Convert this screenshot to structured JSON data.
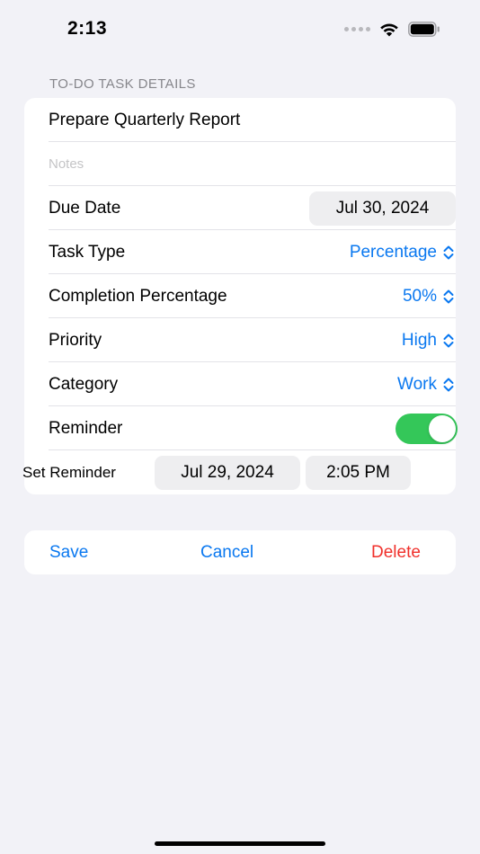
{
  "status_bar": {
    "time": "2:13",
    "icons": [
      "cellular-dots-icon",
      "wifi-icon",
      "battery-icon"
    ]
  },
  "section": {
    "header": "TO-DO TASK DETAILS"
  },
  "task": {
    "title": "Prepare Quarterly Report",
    "notes_placeholder": "Notes"
  },
  "fields": {
    "due_date_label": "Due Date",
    "due_date_value": "Jul 30, 2024",
    "task_type_label": "Task Type",
    "task_type_value": "Percentage",
    "completion_label": "Completion Percentage",
    "completion_value": "50%",
    "priority_label": "Priority",
    "priority_value": "High",
    "category_label": "Category",
    "category_value": "Work",
    "reminder_label": "Reminder",
    "reminder_on": true,
    "set_reminder_label": "Set Reminder",
    "reminder_date": "Jul 29, 2024",
    "reminder_time": "2:05 PM"
  },
  "actions": {
    "save": "Save",
    "cancel": "Cancel",
    "delete": "Delete"
  },
  "colors": {
    "accent": "#0a78f0",
    "destructive": "#f0302b",
    "toggle_on": "#34c759",
    "background": "#f2f2f7"
  }
}
